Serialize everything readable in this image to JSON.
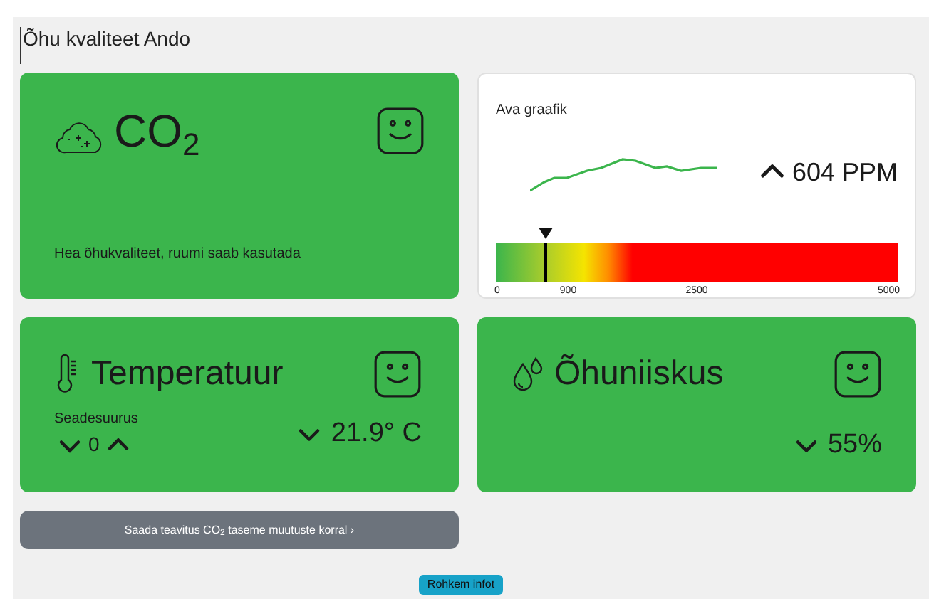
{
  "title": "Õhu kvaliteet Ando",
  "co2_card": {
    "title": "CO$_{2}$",
    "message": "Hea õhukvaliteet, ruumi saab kasutada"
  },
  "chart_card": {
    "link": "Ava graafik",
    "rising": true,
    "reading": "604 PPM",
    "gauge": {
      "level": 0.121,
      "ticks": [
        "0",
        "900",
        "2500",
        "5000"
      ]
    }
  },
  "temperature_card": {
    "title": "Temperatuur",
    "setting_label": "Seadesuurus",
    "setting_value": "0",
    "rising": false,
    "reading": "21.9° C"
  },
  "humidity_card": {
    "title": "Õhuniiskus",
    "rising": false,
    "reading": "55%"
  },
  "notify_button": "Saada teavitus CO$_{2}$ taseme muutuste korral ›",
  "more_button": "Rohkem infot"
}
